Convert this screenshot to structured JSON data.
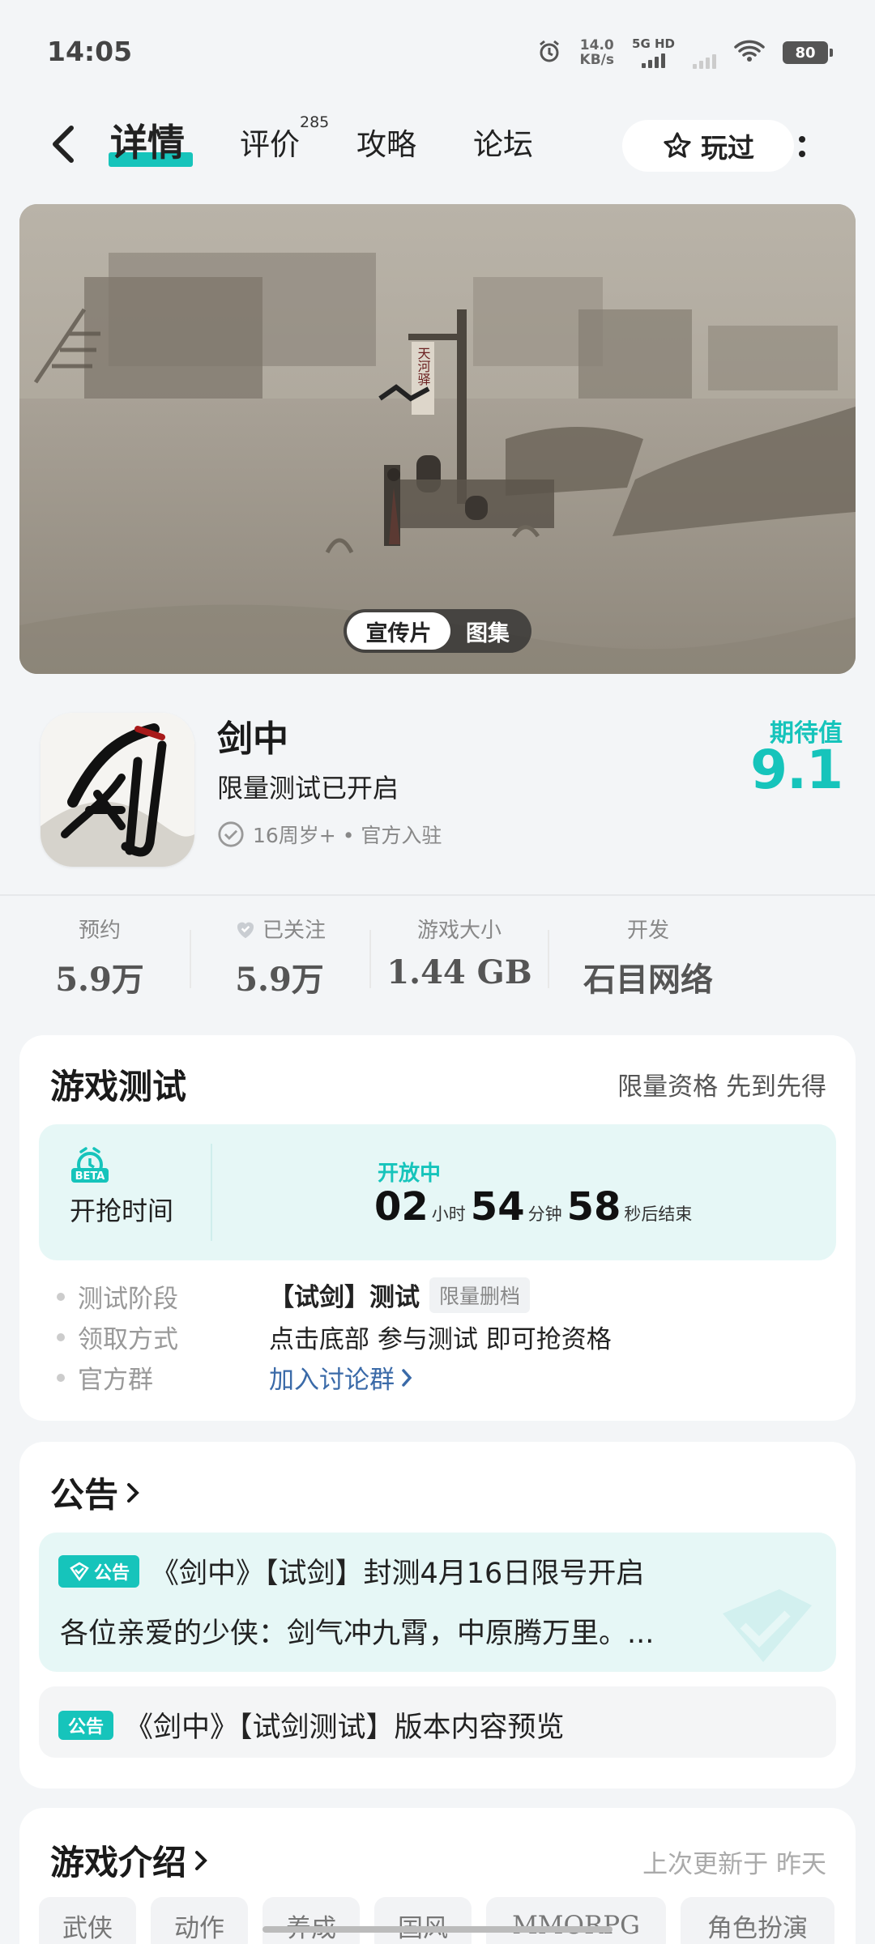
{
  "status_bar": {
    "time": "14:05",
    "net_speed_value": "14.0",
    "net_speed_unit": "KB/s",
    "network_label": "5G HD",
    "battery": "80"
  },
  "nav": {
    "tabs": [
      {
        "label": "详情",
        "active": true
      },
      {
        "label": "评价",
        "count": "285"
      },
      {
        "label": "攻略"
      },
      {
        "label": "论坛"
      }
    ],
    "played_label": "玩过"
  },
  "media": {
    "toggle_video": "宣传片",
    "toggle_gallery": "图集",
    "sign_text": "天河驿"
  },
  "game": {
    "icon_text": "剑",
    "name": "剑中",
    "subtitle": "限量测试已开启",
    "meta": "16周岁+ • 官方入驻",
    "expect_label": "期待值",
    "expect_value": "9.1"
  },
  "stats": [
    {
      "label": "预约",
      "value": "5.9万"
    },
    {
      "label": "已关注",
      "value": "5.9万"
    },
    {
      "label": "游戏大小",
      "value": "1.44 GB"
    },
    {
      "label": "开发",
      "value": "石目网络"
    }
  ],
  "test_section": {
    "title": "游戏测试",
    "right_text": "限量资格 先到先得",
    "beta_badge": "BETA",
    "start_label": "开抢时间",
    "open_status": "开放中",
    "countdown": {
      "hours": "02",
      "hours_unit": "小时",
      "minutes": "54",
      "minutes_unit": "分钟",
      "seconds": "58",
      "seconds_unit": "秒后结束"
    },
    "rows": [
      {
        "label": "测试阶段",
        "value": "【试剑】测试",
        "tag": "限量删档"
      },
      {
        "label": "领取方式",
        "value": "点击底部 参与测试 即可抢资格"
      },
      {
        "label": "官方群",
        "value": "加入讨论群"
      }
    ]
  },
  "notice_section": {
    "title": "公告",
    "badge": "公告",
    "item1_title": "《剑中》【试剑】封测4月16日限号开启",
    "item1_body": "各位亲爱的少侠：剑气冲九霄，中原腾万里。...",
    "item2_title": "《剑中》【试剑测试】版本内容预览"
  },
  "intro_section": {
    "title": "游戏介绍",
    "updated": "上次更新于 昨天",
    "tags": [
      "武侠",
      "动作",
      "养成",
      "国风",
      "MMORPG",
      "角色扮演"
    ]
  },
  "colors": {
    "accent": "#16c4bb",
    "link": "#3a6aa8",
    "background": "#f3f5f7"
  }
}
